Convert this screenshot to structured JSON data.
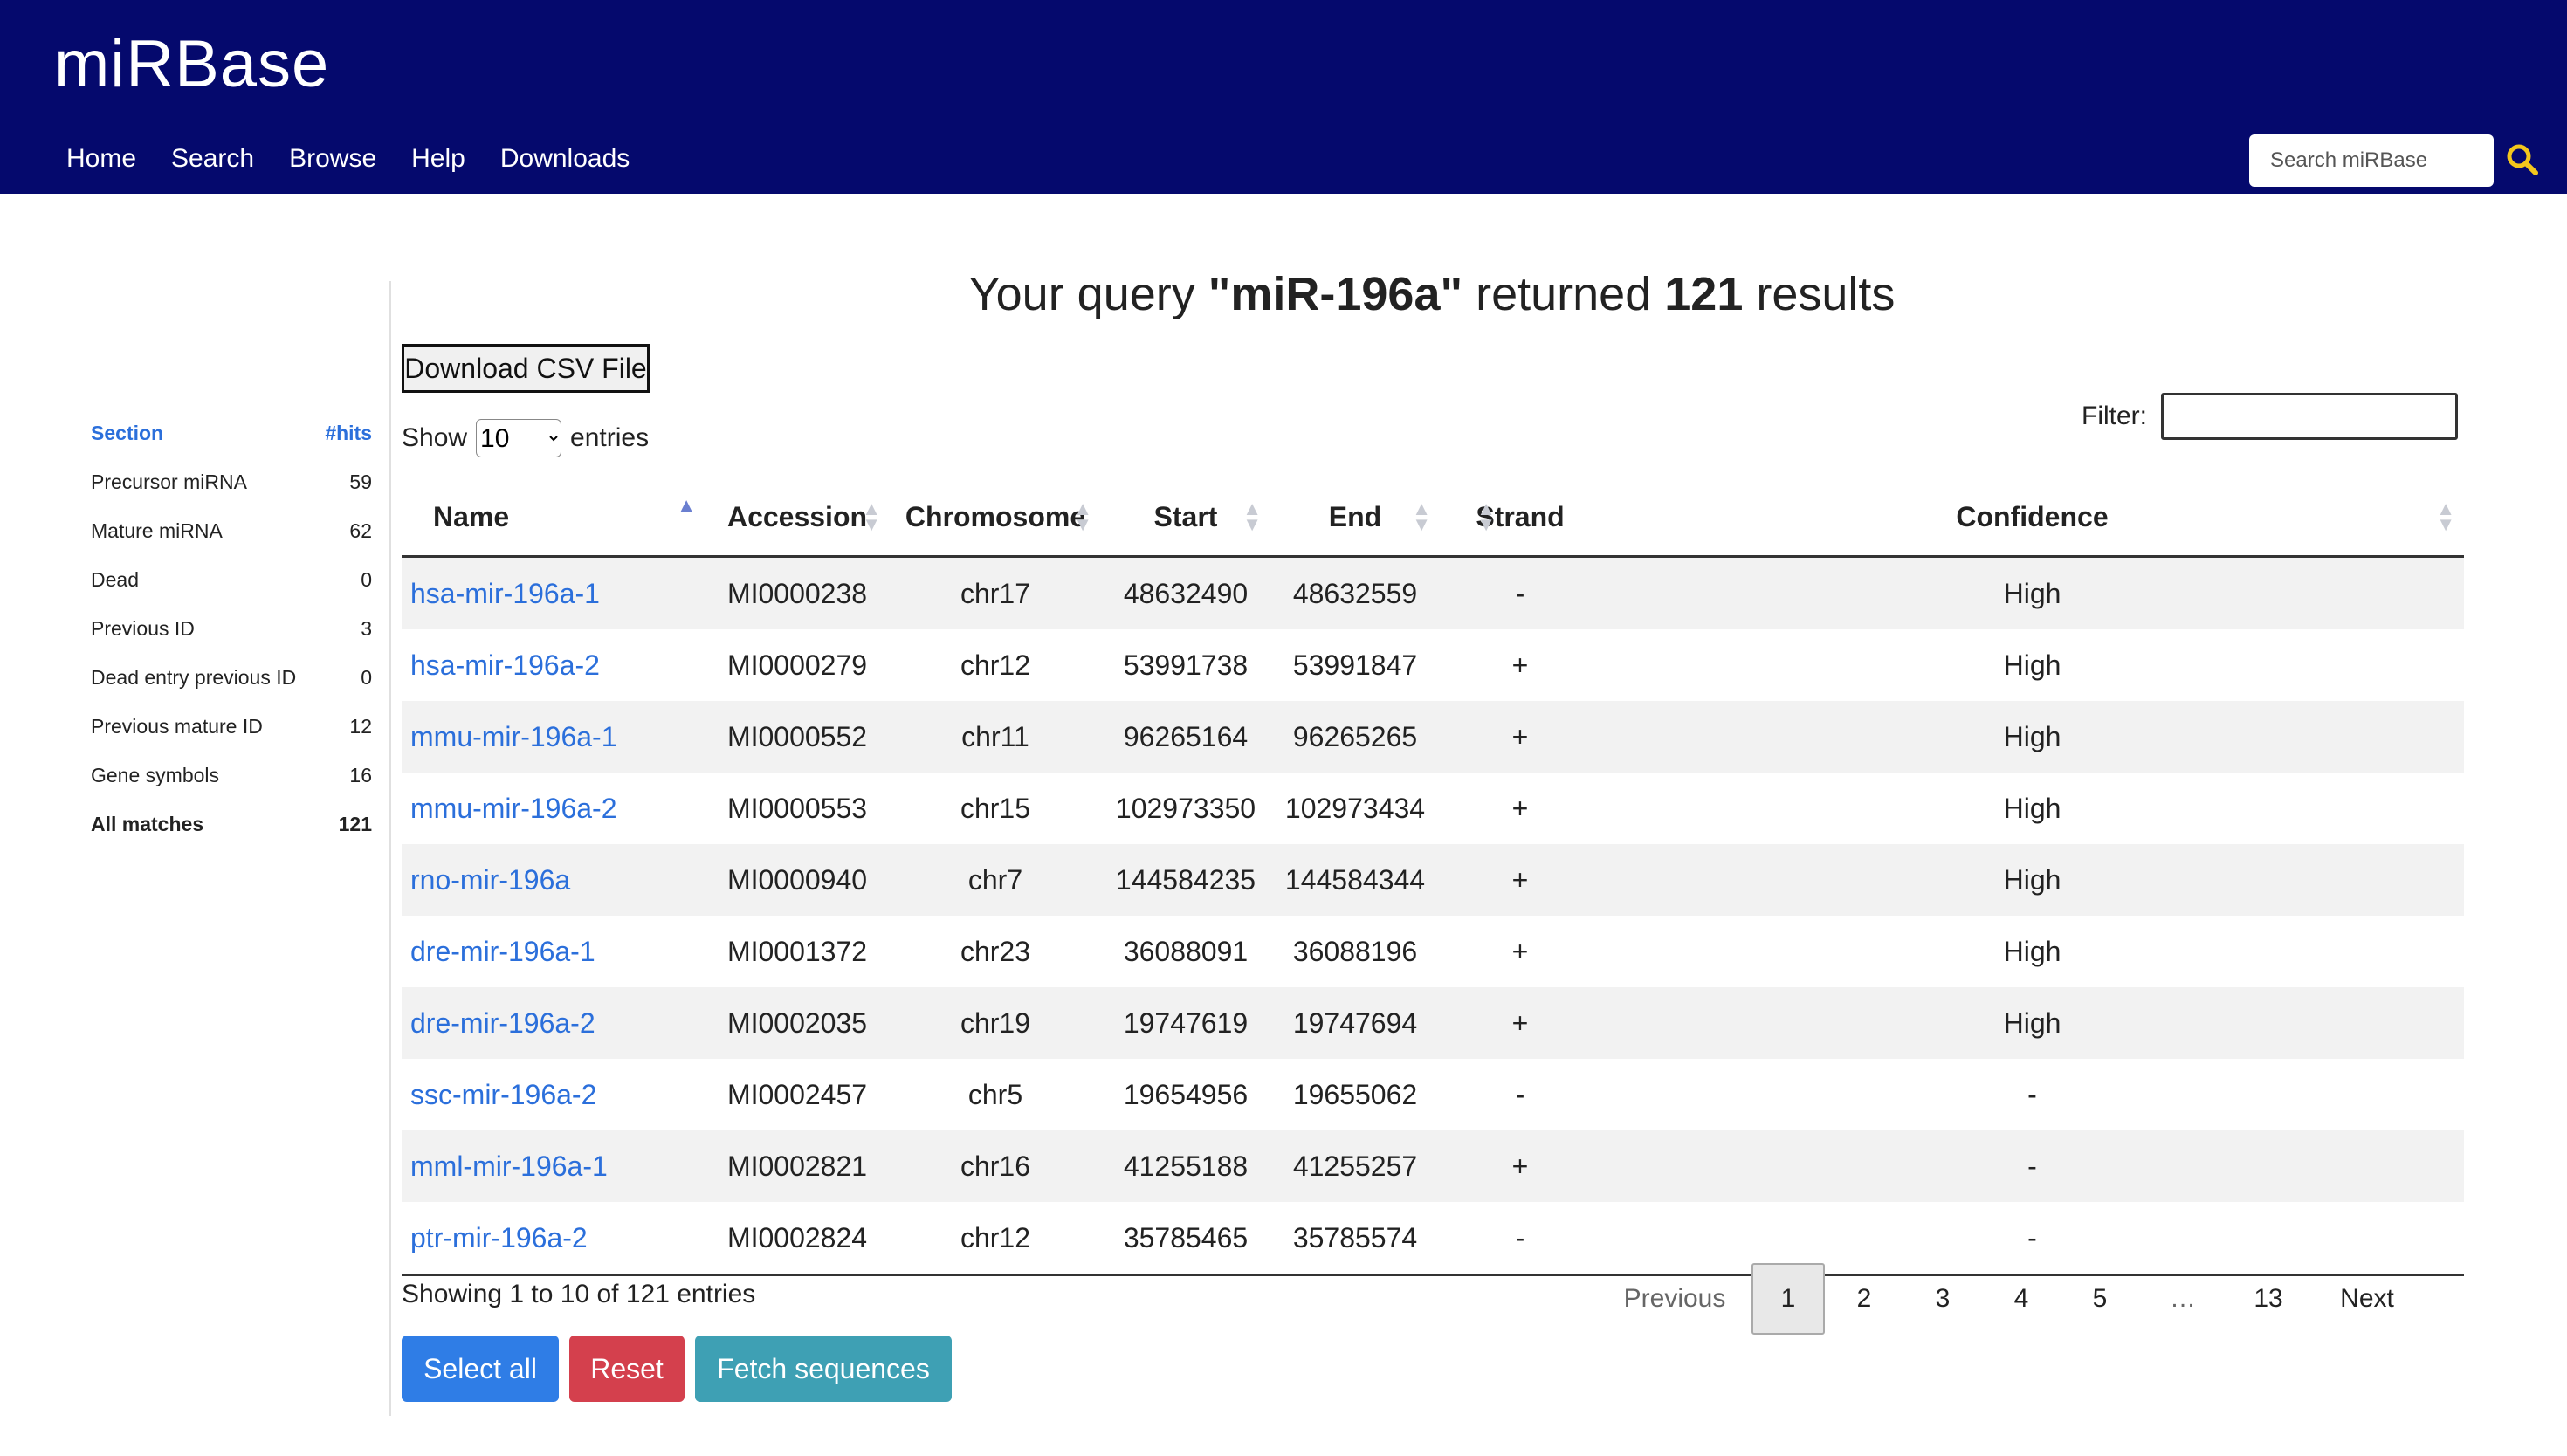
{
  "header": {
    "logo_text": "miRBase",
    "nav": [
      "Home",
      "Search",
      "Browse",
      "Help",
      "Downloads"
    ],
    "search_placeholder": "Search miRBase"
  },
  "sidebar": {
    "header": {
      "section": "Section",
      "hits": "#hits"
    },
    "items": [
      {
        "label": "Precursor miRNA",
        "count": "59"
      },
      {
        "label": "Mature miRNA",
        "count": "62"
      },
      {
        "label": "Dead",
        "count": "0"
      },
      {
        "label": "Previous ID",
        "count": "3"
      },
      {
        "label": "Dead entry previous ID",
        "count": "0"
      },
      {
        "label": "Previous mature ID",
        "count": "12"
      },
      {
        "label": "Gene symbols",
        "count": "16"
      },
      {
        "label": "All matches",
        "count": "121"
      }
    ]
  },
  "main": {
    "title_prefix": "Your query ",
    "query": "\"miR-196a\"",
    "title_middle": " returned ",
    "count": "121",
    "title_suffix": " results",
    "download_csv": "Download CSV File",
    "show_label": "Show",
    "entries_label": "entries",
    "page_size": "10",
    "filter_label": "Filter:"
  },
  "table": {
    "columns": [
      "Name",
      "Accession",
      "Chromosome",
      "Start",
      "End",
      "Strand",
      "Confidence"
    ],
    "rows": [
      [
        "hsa-mir-196a-1",
        "MI0000238",
        "chr17",
        "48632490",
        "48632559",
        "-",
        "High"
      ],
      [
        "hsa-mir-196a-2",
        "MI0000279",
        "chr12",
        "53991738",
        "53991847",
        "+",
        "High"
      ],
      [
        "mmu-mir-196a-1",
        "MI0000552",
        "chr11",
        "96265164",
        "96265265",
        "+",
        "High"
      ],
      [
        "mmu-mir-196a-2",
        "MI0000553",
        "chr15",
        "102973350",
        "102973434",
        "+",
        "High"
      ],
      [
        "rno-mir-196a",
        "MI0000940",
        "chr7",
        "144584235",
        "144584344",
        "+",
        "High"
      ],
      [
        "dre-mir-196a-1",
        "MI0001372",
        "chr23",
        "36088091",
        "36088196",
        "+",
        "High"
      ],
      [
        "dre-mir-196a-2",
        "MI0002035",
        "chr19",
        "19747619",
        "19747694",
        "+",
        "High"
      ],
      [
        "ssc-mir-196a-2",
        "MI0002457",
        "chr5",
        "19654956",
        "19655062",
        "-",
        "-"
      ],
      [
        "mml-mir-196a-1",
        "MI0002821",
        "chr16",
        "41255188",
        "41255257",
        "+",
        "-"
      ],
      [
        "ptr-mir-196a-2",
        "MI0002824",
        "chr12",
        "35785465",
        "35785574",
        "-",
        "-"
      ]
    ]
  },
  "footer": {
    "info": "Showing 1 to 10 of 121 entries",
    "pagination": {
      "previous": "Previous",
      "pages": [
        "1",
        "2",
        "3",
        "4",
        "5",
        "…",
        "13"
      ],
      "next": "Next",
      "current": "1"
    },
    "buttons": {
      "select_all": "Select all",
      "reset": "Reset",
      "fetch": "Fetch sequences"
    }
  },
  "colors": {
    "header_bg": "#05096d",
    "link": "#2b6fdb",
    "select_all": "#2f7de6",
    "reset": "#d4404d",
    "fetch": "#3ea0b4",
    "search_icon": "#f3c61d"
  },
  "icons": {
    "search": "search-icon",
    "sort": "sort-arrows-icon"
  }
}
